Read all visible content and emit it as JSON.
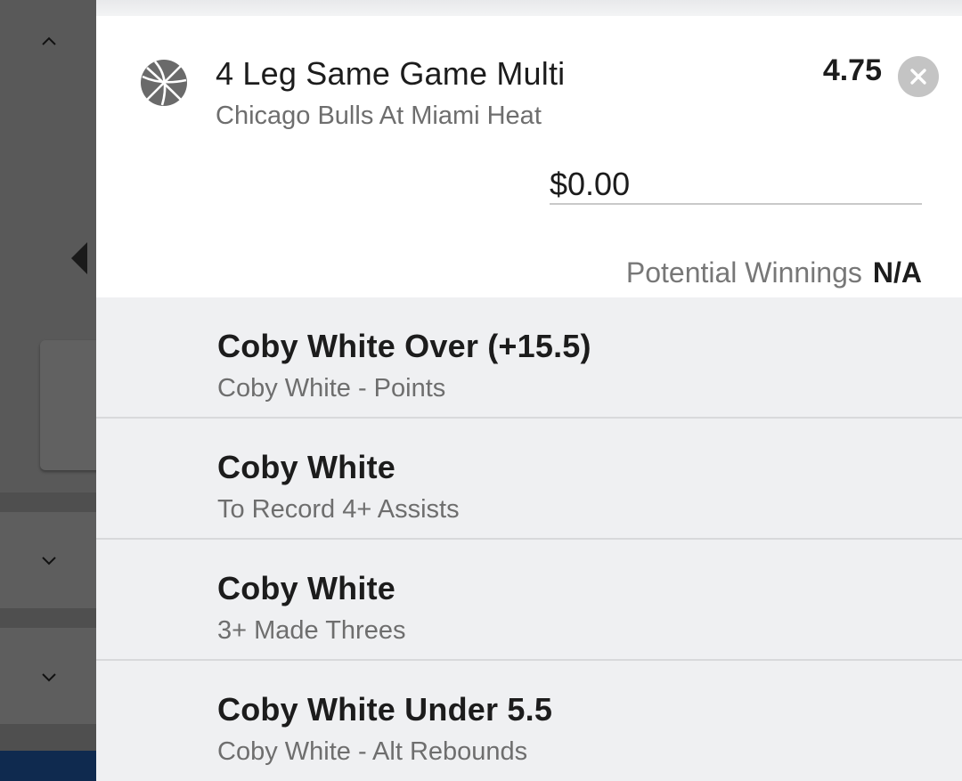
{
  "bet": {
    "title": "4 Leg Same Game Multi",
    "event": "Chicago Bulls At Miami Heat",
    "odds": "4.75",
    "stake_value": "$0.00",
    "potential_winnings_label": "Potential Winnings",
    "potential_winnings_value": "N/A",
    "sport_icon": "basketball-icon"
  },
  "legs": [
    {
      "selection": "Coby White Over (+15.5)",
      "market": "Coby White - Points"
    },
    {
      "selection": "Coby White",
      "market": "To Record 4+ Assists"
    },
    {
      "selection": "Coby White",
      "market": "3+ Made Threes"
    },
    {
      "selection": "Coby White Under 5.5",
      "market": "Coby White - Alt Rebounds"
    }
  ],
  "colors": {
    "panel_bg": "#ffffff",
    "leg_bg": "#eff0f2",
    "dim_overlay": "#595959",
    "text_primary": "#1c1c1c",
    "text_secondary": "#6e6e6e",
    "remove_button": "#c4c4c4"
  }
}
